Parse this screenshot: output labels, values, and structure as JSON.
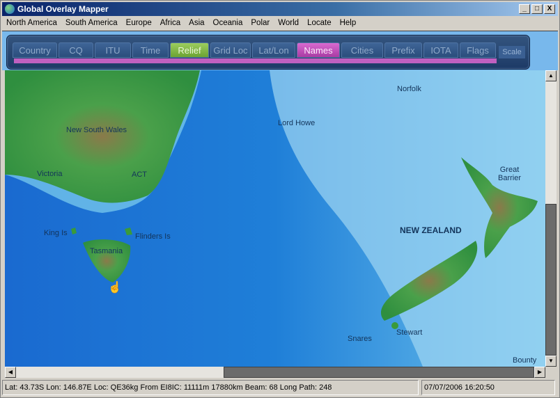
{
  "window": {
    "title": "Global Overlay Mapper",
    "minimize": "_",
    "maximize": "□",
    "close": "X"
  },
  "menu": [
    "North America",
    "South America",
    "Europe",
    "Africa",
    "Asia",
    "Oceania",
    "Polar",
    "World",
    "Locate",
    "Help"
  ],
  "tabs": [
    {
      "label": "Country"
    },
    {
      "label": "CQ"
    },
    {
      "label": "ITU"
    },
    {
      "label": "Time"
    },
    {
      "label": "Relief",
      "state": "active-green"
    },
    {
      "label": "Grid Loc"
    },
    {
      "label": "Lat/Lon"
    },
    {
      "label": "Names",
      "state": "active-pink"
    },
    {
      "label": "Cities"
    },
    {
      "label": "Prefix"
    },
    {
      "label": "IOTA"
    },
    {
      "label": "Flags"
    }
  ],
  "scale_label": "Scale",
  "map_labels": {
    "norfolk": "Norfolk",
    "nsw": "New South Wales",
    "lord_howe": "Lord Howe",
    "victoria": "Victoria",
    "act": "ACT",
    "great_barrier": "Great\nBarrier",
    "king": "King Is",
    "flinders": "Flinders Is",
    "tasmania": "Tasmania",
    "nz": "NEW ZEALAND",
    "snares": "Snares",
    "stewart": "Stewart",
    "bounty": "Bounty"
  },
  "status": {
    "info": "Lat: 43.73S  Lon: 146.87E  Loc: QE36kg  From EI8IC: 11111m  17880km  Beam: 68  Long Path: 248",
    "datetime": "07/07/2006 16:20:50"
  },
  "colors": {
    "relief": "#7fbb45",
    "names": "#c060c0"
  }
}
